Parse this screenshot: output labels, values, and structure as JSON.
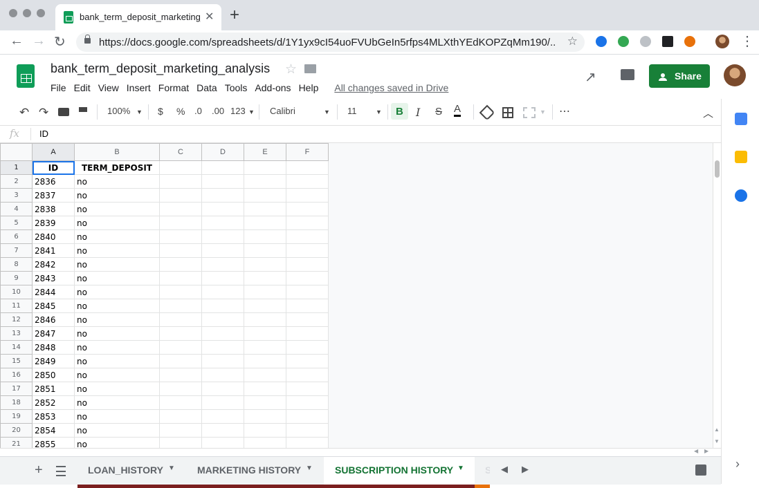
{
  "browser": {
    "tab_title": "bank_term_deposit_marketing_",
    "url": "https://docs.google.com/spreadsheets/d/1Y1yx9cI54uoFVUbGeIn5rfps4MLXthYEdKOPZqMm190/..."
  },
  "doc": {
    "title": "bank_term_deposit_marketing_analysis",
    "menu": [
      "File",
      "Edit",
      "View",
      "Insert",
      "Format",
      "Data",
      "Tools",
      "Add-ons",
      "Help"
    ],
    "save_status": "All changes saved in Drive",
    "share_label": "Share"
  },
  "toolbar": {
    "zoom": "100%",
    "currency": "$",
    "percent": "%",
    "dec_less": ".0",
    "dec_more": ".00",
    "format_more": "123",
    "font": "Calibri",
    "font_size": "11",
    "bold": "B",
    "italic": "I",
    "strike": "S",
    "text_color": "A",
    "more": "⋯"
  },
  "formula_bar": {
    "fx": "fx",
    "value": "ID"
  },
  "grid": {
    "columns": [
      "A",
      "B",
      "C",
      "D",
      "E",
      "F"
    ],
    "rows": [
      [
        "1",
        "ID",
        "TERM_DEPOSIT"
      ],
      [
        "2",
        "2836",
        "no"
      ],
      [
        "3",
        "2837",
        "no"
      ],
      [
        "4",
        "2838",
        "no"
      ],
      [
        "5",
        "2839",
        "no"
      ],
      [
        "6",
        "2840",
        "no"
      ],
      [
        "7",
        "2841",
        "no"
      ],
      [
        "8",
        "2842",
        "no"
      ],
      [
        "9",
        "2843",
        "no"
      ],
      [
        "10",
        "2844",
        "no"
      ],
      [
        "11",
        "2845",
        "no"
      ],
      [
        "12",
        "2846",
        "no"
      ],
      [
        "13",
        "2847",
        "no"
      ],
      [
        "14",
        "2848",
        "no"
      ],
      [
        "15",
        "2849",
        "no"
      ],
      [
        "16",
        "2850",
        "no"
      ],
      [
        "17",
        "2851",
        "no"
      ],
      [
        "18",
        "2852",
        "no"
      ],
      [
        "19",
        "2853",
        "no"
      ],
      [
        "20",
        "2854",
        "no"
      ],
      [
        "21",
        "2855",
        "no"
      ]
    ]
  },
  "sheets": {
    "tab1": "LOAN_HISTORY",
    "tab2": "MARKETING HISTORY",
    "tab3": "SUBSCRIPTION HISTORY",
    "tab4": "S"
  },
  "colors": {
    "accent": "#188038",
    "active_sheet": "#137333",
    "selection": "#1a73e8"
  }
}
